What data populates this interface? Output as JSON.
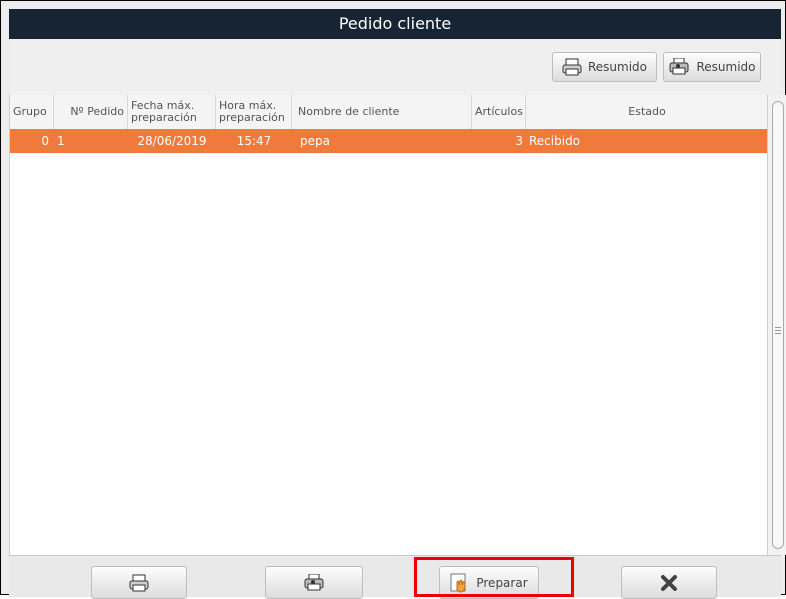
{
  "window": {
    "title": "Pedido cliente"
  },
  "toolbar": {
    "resumido_1": {
      "label": "Resumido",
      "icon": "printer-icon"
    },
    "resumido_2": {
      "label": "Resumido",
      "icon": "printer-group-icon"
    }
  },
  "table": {
    "columns": [
      "Grupo",
      "Nº Pedido",
      "Fecha máx. preparación",
      "Hora máx. preparación",
      "Nombre de cliente",
      "Artículos",
      "Estado"
    ],
    "rows": [
      {
        "grupo": "0",
        "pedido": "1",
        "fecha": "28/06/2019",
        "hora": "15:47",
        "cliente": "pepa",
        "articulos": "3",
        "estado": "Recibido"
      }
    ]
  },
  "bottom": {
    "print": {
      "icon": "printer-icon"
    },
    "print_group": {
      "icon": "printer-group-icon"
    },
    "preparar": {
      "label": "Preparar",
      "icon": "prepare-hand-icon"
    },
    "close": {
      "icon": "close-icon"
    }
  },
  "colors": {
    "title_bg": "#172433",
    "selected_row": "#ef7a3c",
    "highlight": "#e00000"
  }
}
